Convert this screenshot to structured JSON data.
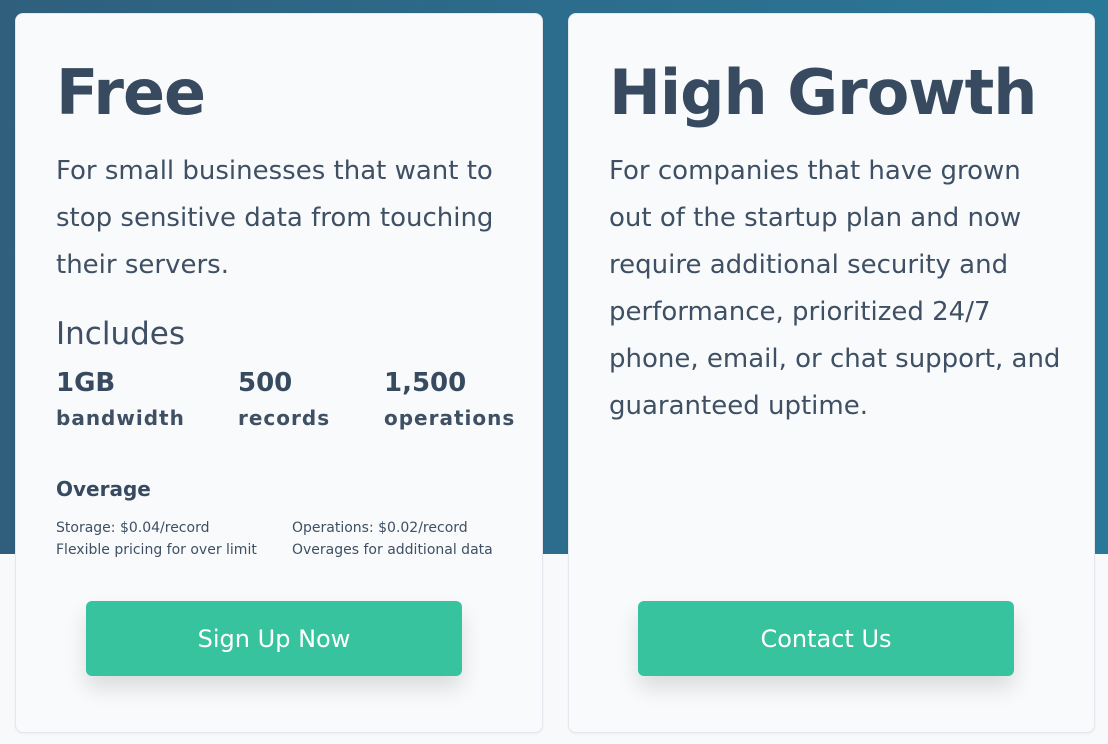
{
  "colors": {
    "hero_background": "#2c6c8c",
    "card_background": "#f8fafb",
    "heading_text": "#374a60",
    "cta_button": "#38c39f",
    "cta_text": "#ffffff"
  },
  "plans": [
    {
      "title": "Free",
      "description": "For small businesses that want to stop sensitive data from touching their servers.",
      "includes_label": "Includes",
      "stats": [
        {
          "value": "1GB",
          "unit": "bandwidth"
        },
        {
          "value": "500",
          "unit": "records"
        },
        {
          "value": "1,500",
          "unit": "operations"
        }
      ],
      "overage_label": "Overage",
      "overage": [
        {
          "price": "Storage: $0.04/record",
          "note": "Flexible pricing for over limit"
        },
        {
          "price": "Operations: $0.02/record",
          "note": "Overages for additional data"
        }
      ],
      "cta_label": "Sign Up Now"
    },
    {
      "title": "High Growth",
      "description": "For companies that have grown out of the startup plan and now require additional security and performance, prioritized 24/7 phone, email, or chat support, and guaranteed uptime.",
      "cta_label": "Contact Us"
    }
  ]
}
